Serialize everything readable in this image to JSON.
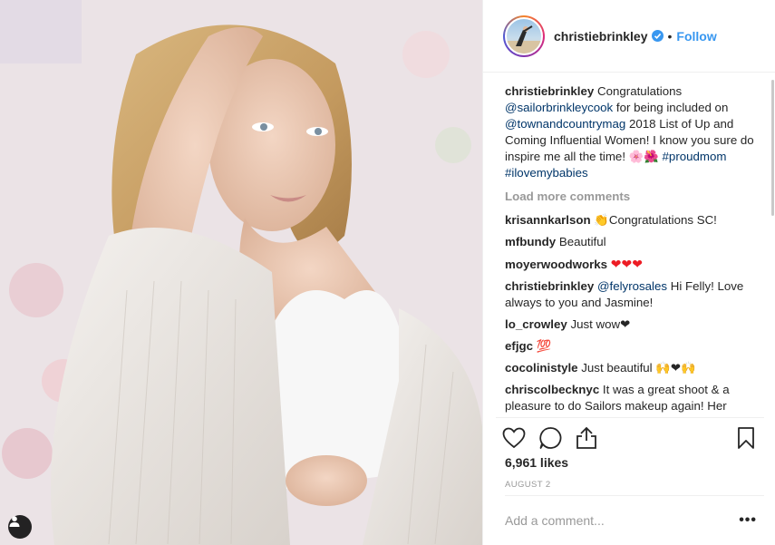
{
  "post": {
    "username": "christiebrinkley",
    "follow_label": "Follow",
    "separator": "•",
    "caption": {
      "username": "christiebrinkley",
      "text_1": "Congratulations",
      "mention_1": "@sailorbrinkleycook",
      "text_2": "for being included on",
      "mention_2": "@townandcountrymag",
      "text_3": "2018 List of Up and Coming Influential Women! I know you sure do inspire me all the time! 🌸🌺",
      "hashtag_1": "#proudmom",
      "hashtag_2": "#ilovemybabies"
    },
    "load_more_label": "Load more comments",
    "comments": [
      {
        "username": "krisannkarlson",
        "text": "👏Congratulations SC!"
      },
      {
        "username": "mfbundy",
        "text": "Beautiful"
      },
      {
        "username": "moyerwoodworks",
        "text": "❤❤❤"
      },
      {
        "username": "christiebrinkley",
        "mention": "@felyrosales",
        "text": "Hi Felly! Love always to you and Jasmine!"
      },
      {
        "username": "lo_crowley",
        "text": "Just wow❤"
      },
      {
        "username": "efjgc",
        "text": "💯"
      },
      {
        "username": "cocolinistyle",
        "text": "Just beautiful 🙌❤🙌"
      },
      {
        "username": "chriscolbecknyc",
        "text": "It was a great shoot & a pleasure to do Sailors makeup again! Her"
      }
    ],
    "likes_label": "6,961 likes",
    "date_label": "AUGUST 2",
    "comment_placeholder": "Add a comment...",
    "more_label": "•••"
  },
  "icons": [
    "heart-icon",
    "comment-icon",
    "share-icon",
    "bookmark-icon",
    "verified-badge-icon",
    "user-tag-icon"
  ],
  "colors": {
    "link": "#3897f0",
    "mention": "#003569",
    "muted": "#999999",
    "verified": "#3897f0"
  }
}
